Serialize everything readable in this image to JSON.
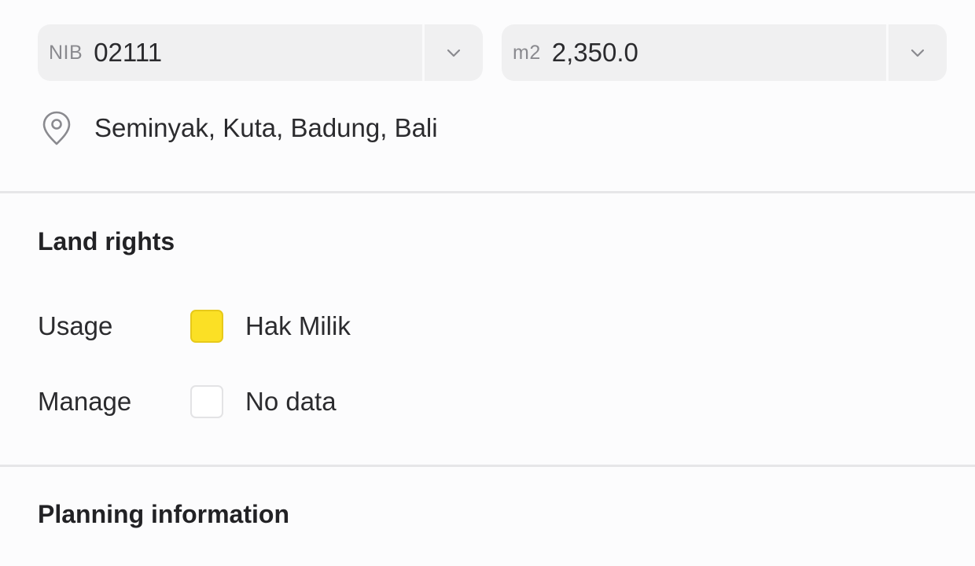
{
  "parcel_fields": {
    "nib": {
      "prefix": "NIB",
      "value": "02111"
    },
    "area": {
      "prefix": "m2",
      "value": "2,350.0"
    }
  },
  "location": {
    "address": "Seminyak, Kuta, Badung, Bali"
  },
  "land_rights": {
    "title": "Land rights",
    "rows": [
      {
        "label": "Usage",
        "value": "Hak Milik",
        "swatch_color": "#fbe025"
      },
      {
        "label": "Manage",
        "value": "No data",
        "swatch_color": "#ffffff"
      }
    ]
  },
  "planning": {
    "title": "Planning information"
  },
  "icons": {
    "dropdown": "chevron-down-icon",
    "location": "location-pin-icon"
  }
}
